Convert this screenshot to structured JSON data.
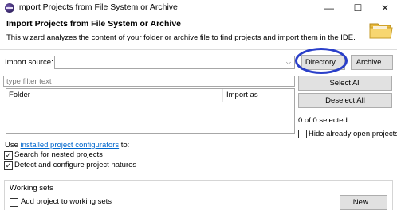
{
  "window": {
    "title": "Import Projects from File System or Archive",
    "minimize_glyph": "—",
    "maximize_glyph": "☐",
    "close_glyph": "✕"
  },
  "header": {
    "title": "Import Projects from File System or Archive",
    "description": "This wizard analyzes the content of your folder or archive file to find projects and import them in the IDE."
  },
  "import_source": {
    "label": "Import source:",
    "value": "",
    "directory_button": "Directory...",
    "archive_button": "Archive..."
  },
  "filter": {
    "placeholder": "type filter text"
  },
  "table": {
    "columns": [
      "Folder",
      "Import as"
    ],
    "rows": []
  },
  "side_buttons": {
    "select_all": "Select All",
    "deselect_all": "Deselect All",
    "selection_count": "0 of 0 selected",
    "hide_open_label": "Hide already open projects"
  },
  "options": {
    "use_prefix": "Use ",
    "configurators_link": "installed project configurators",
    "use_suffix": " to:",
    "search_nested": "Search for nested projects",
    "detect_configure": "Detect and configure project natures",
    "search_nested_checked": true,
    "detect_configure_checked": true,
    "hide_open_checked": false,
    "check_glyph": "✓"
  },
  "working_sets": {
    "title": "Working sets",
    "add_label": "Add project to working sets",
    "add_checked": false,
    "new_button": "New..."
  },
  "colors": {
    "annotation_ellipse": "#2a3fc9",
    "link": "#0066cc",
    "accent_folder": "#f3c85c"
  }
}
